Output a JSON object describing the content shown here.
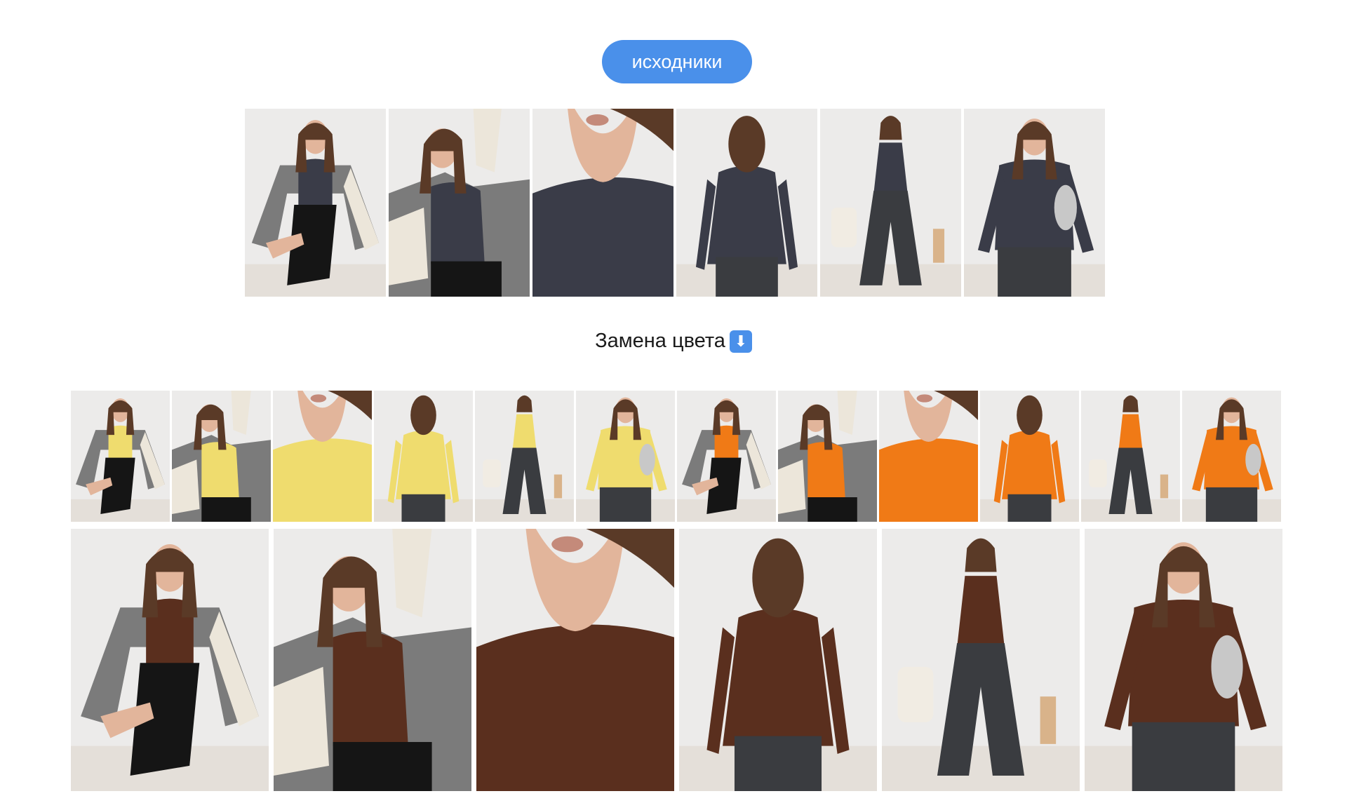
{
  "header": {
    "button_label": "исходники"
  },
  "section": {
    "title": "Замена цвета",
    "icon": "down-arrow-icon",
    "icon_glyph": "⬇"
  },
  "colors": {
    "accent": "#4a90ea",
    "original": "#3a3c48",
    "yellow": "#efdc6e",
    "orange": "#f07a16",
    "brown": "#5a2f1e"
  },
  "originals": [
    {
      "pose": "seated-with-jacket",
      "color": "original"
    },
    {
      "pose": "jacket-closeup",
      "color": "original"
    },
    {
      "pose": "neckline-detail",
      "color": "original"
    },
    {
      "pose": "back-view",
      "color": "original"
    },
    {
      "pose": "full-length-jeans",
      "color": "original"
    },
    {
      "pose": "with-silver-bag",
      "color": "original"
    }
  ],
  "recolored_small": [
    {
      "pose": "seated-with-jacket",
      "color": "yellow"
    },
    {
      "pose": "jacket-closeup",
      "color": "yellow"
    },
    {
      "pose": "neckline-detail",
      "color": "yellow"
    },
    {
      "pose": "back-view",
      "color": "yellow"
    },
    {
      "pose": "full-length-jeans",
      "color": "yellow"
    },
    {
      "pose": "with-silver-bag",
      "color": "yellow"
    },
    {
      "pose": "seated-with-jacket",
      "color": "orange"
    },
    {
      "pose": "jacket-closeup",
      "color": "orange"
    },
    {
      "pose": "neckline-detail",
      "color": "orange"
    },
    {
      "pose": "back-view",
      "color": "orange"
    },
    {
      "pose": "full-length-jeans",
      "color": "orange"
    },
    {
      "pose": "with-silver-bag",
      "color": "orange"
    }
  ],
  "recolored_large": [
    {
      "pose": "seated-with-jacket",
      "color": "brown"
    },
    {
      "pose": "jacket-closeup",
      "color": "brown"
    },
    {
      "pose": "neckline-detail",
      "color": "brown"
    },
    {
      "pose": "back-view",
      "color": "brown"
    },
    {
      "pose": "full-length-jeans",
      "color": "brown"
    },
    {
      "pose": "with-silver-bag",
      "color": "brown"
    }
  ]
}
